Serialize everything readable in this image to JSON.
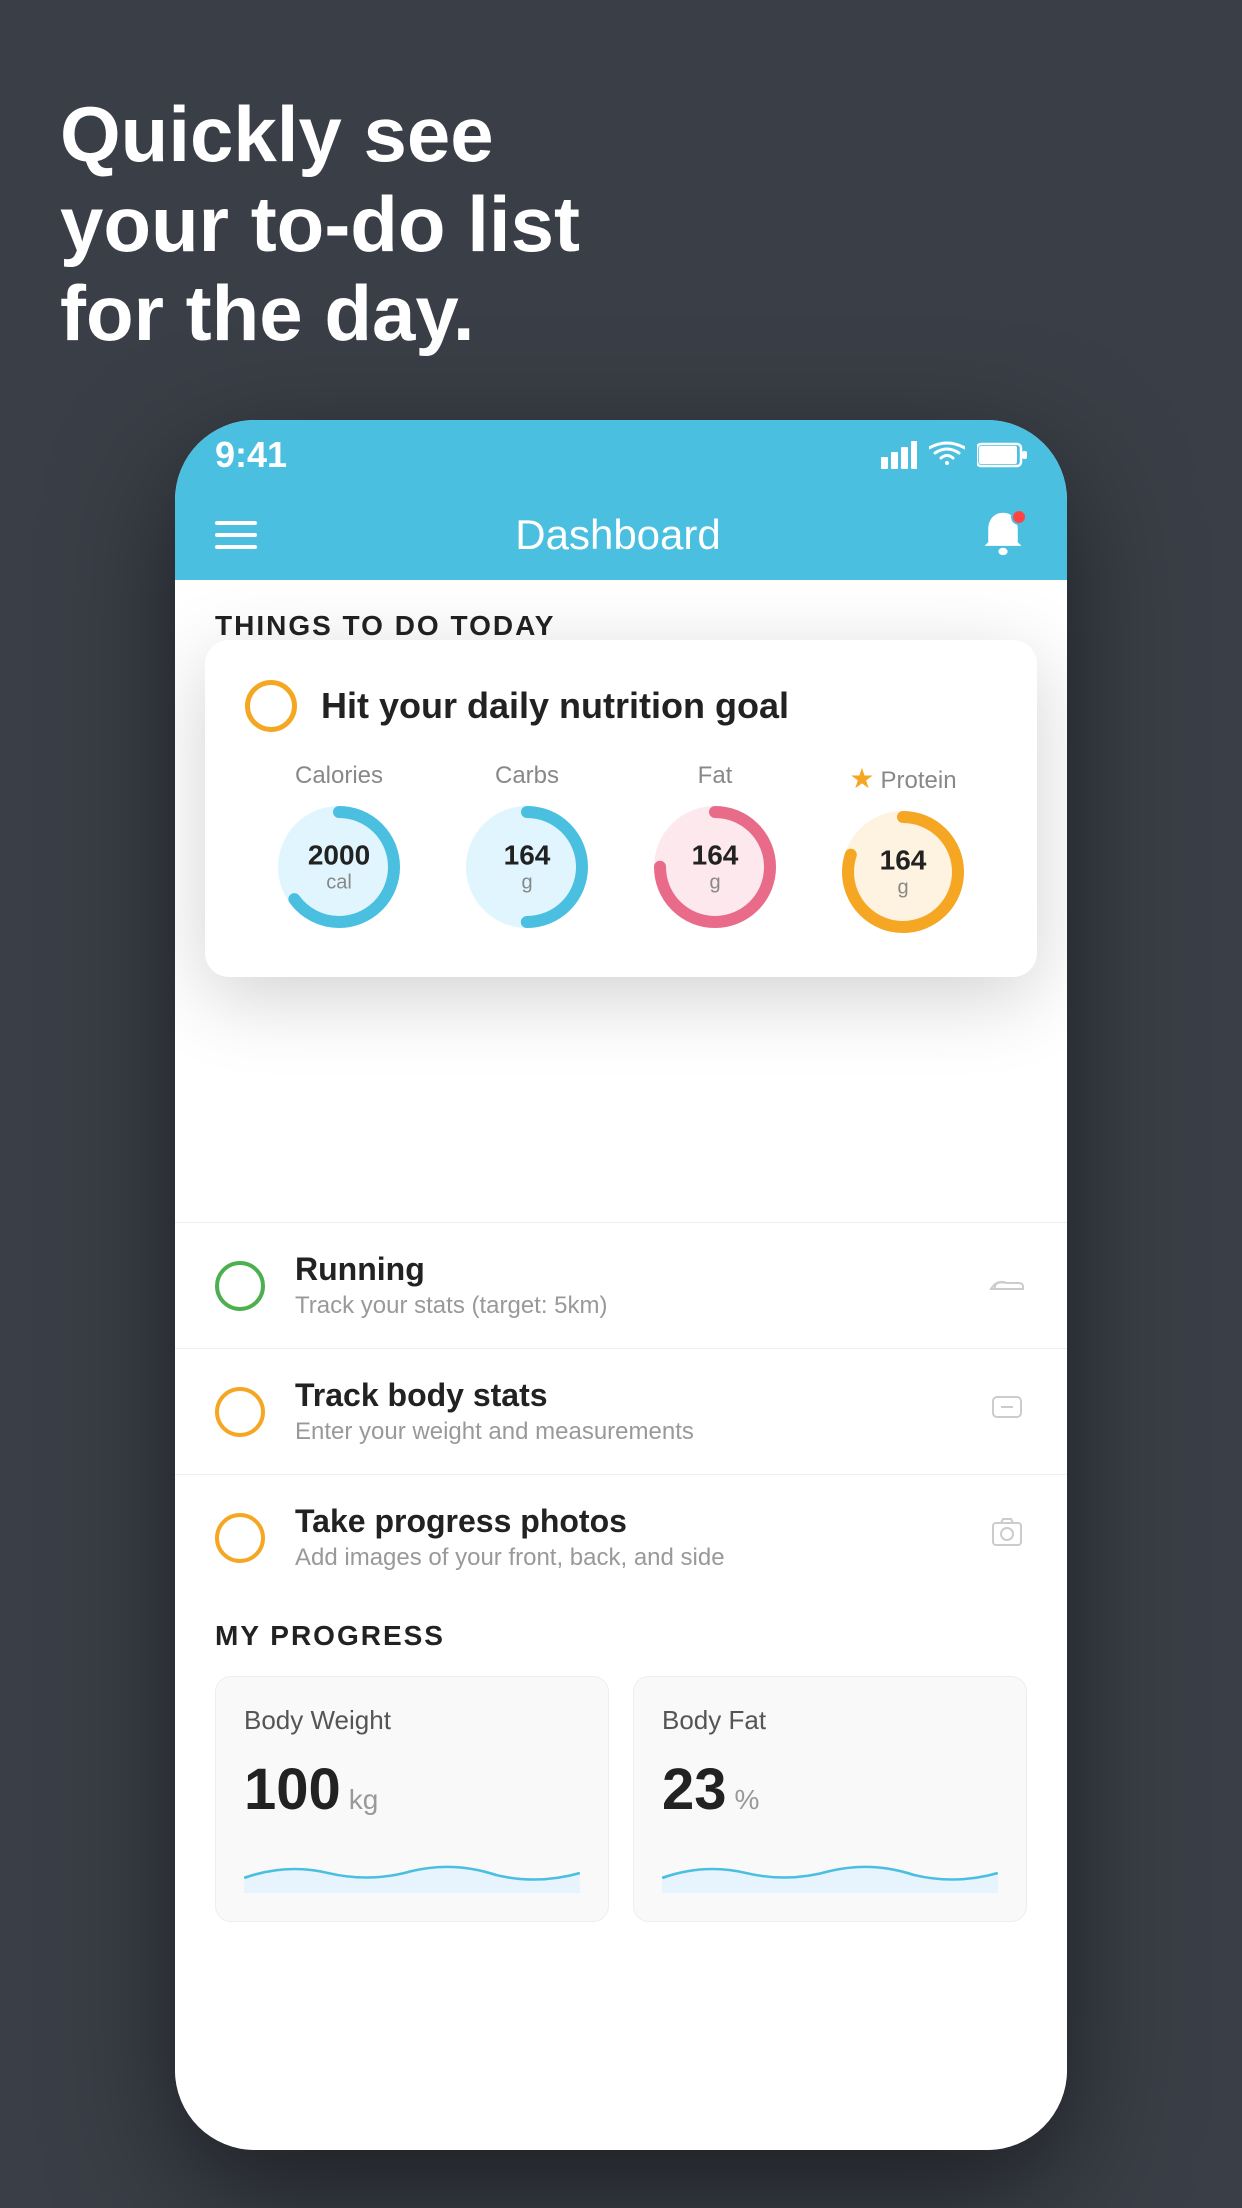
{
  "headline": {
    "line1": "Quickly see",
    "line2": "your to-do list",
    "line3": "for the day."
  },
  "statusBar": {
    "time": "9:41"
  },
  "navBar": {
    "title": "Dashboard"
  },
  "thingsToDoSection": {
    "label": "THINGS TO DO TODAY"
  },
  "floatingCard": {
    "title": "Hit your daily nutrition goal",
    "macros": [
      {
        "label": "Calories",
        "value": "2000",
        "unit": "cal",
        "color": "#4bbfe0",
        "trackColor": "#e0f5fd",
        "progress": 65
      },
      {
        "label": "Carbs",
        "value": "164",
        "unit": "g",
        "color": "#4bbfe0",
        "trackColor": "#e0f5fd",
        "progress": 50
      },
      {
        "label": "Fat",
        "value": "164",
        "unit": "g",
        "color": "#e86c8a",
        "trackColor": "#fde8ed",
        "progress": 75
      },
      {
        "label": "Protein",
        "value": "164",
        "unit": "g",
        "color": "#f5a623",
        "trackColor": "#fef3e0",
        "progress": 80
      }
    ]
  },
  "todoItems": [
    {
      "title": "Running",
      "subtitle": "Track your stats (target: 5km)",
      "circleType": "green",
      "icon": "shoe"
    },
    {
      "title": "Track body stats",
      "subtitle": "Enter your weight and measurements",
      "circleType": "yellow",
      "icon": "scale"
    },
    {
      "title": "Take progress photos",
      "subtitle": "Add images of your front, back, and side",
      "circleType": "yellow",
      "icon": "photo"
    }
  ],
  "progressSection": {
    "title": "MY PROGRESS",
    "cards": [
      {
        "title": "Body Weight",
        "value": "100",
        "unit": "kg"
      },
      {
        "title": "Body Fat",
        "value": "23",
        "unit": "%"
      }
    ]
  }
}
